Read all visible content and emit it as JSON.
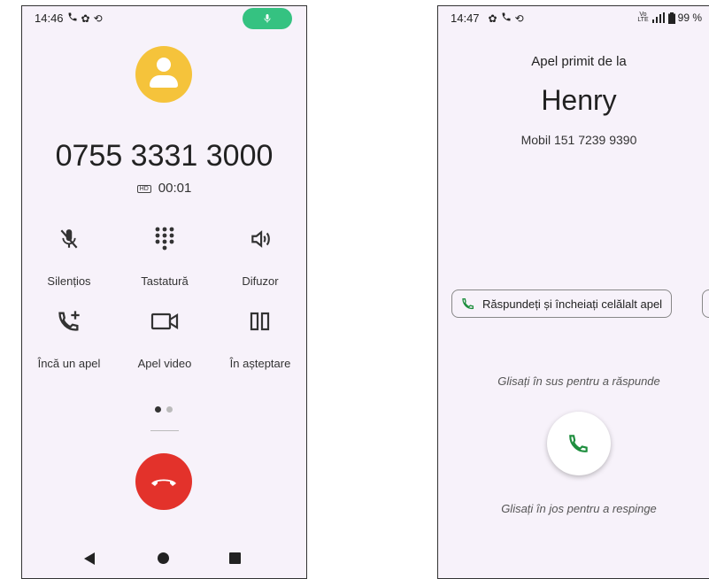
{
  "left_screen": {
    "status": {
      "time": "14:46"
    },
    "caller_number": "0755 3331 3000",
    "call_timer": "00:01",
    "hd_badge": "HD",
    "controls": [
      {
        "label": "Silențios",
        "icon": "mic-off-icon"
      },
      {
        "label": "Tastatură",
        "icon": "dialpad-icon"
      },
      {
        "label": "Difuzor",
        "icon": "speaker-icon"
      },
      {
        "label": "Încă un apel",
        "icon": "add-call-icon"
      },
      {
        "label": "Apel video",
        "icon": "video-icon"
      },
      {
        "label": "În așteptare",
        "icon": "pause-icon"
      }
    ],
    "colors": {
      "end_call": "#e3322b",
      "mic_pill": "#35c281",
      "avatar": "#f5c33b"
    }
  },
  "right_screen": {
    "status": {
      "time": "14:47",
      "battery": "99 %",
      "network": "VoLTE 4G"
    },
    "subtitle": "Apel primit de la",
    "caller_name": "Henry",
    "caller_detail": "Mobil 151 7239 9390",
    "chip_label": "Răspundeți și încheiați celălalt apel",
    "swipe_up_hint": "Glisați în sus pentru a răspunde",
    "swipe_down_hint": "Glisați în jos pentru a respinge",
    "colors": {
      "answer_icon": "#1e8e3e"
    }
  }
}
